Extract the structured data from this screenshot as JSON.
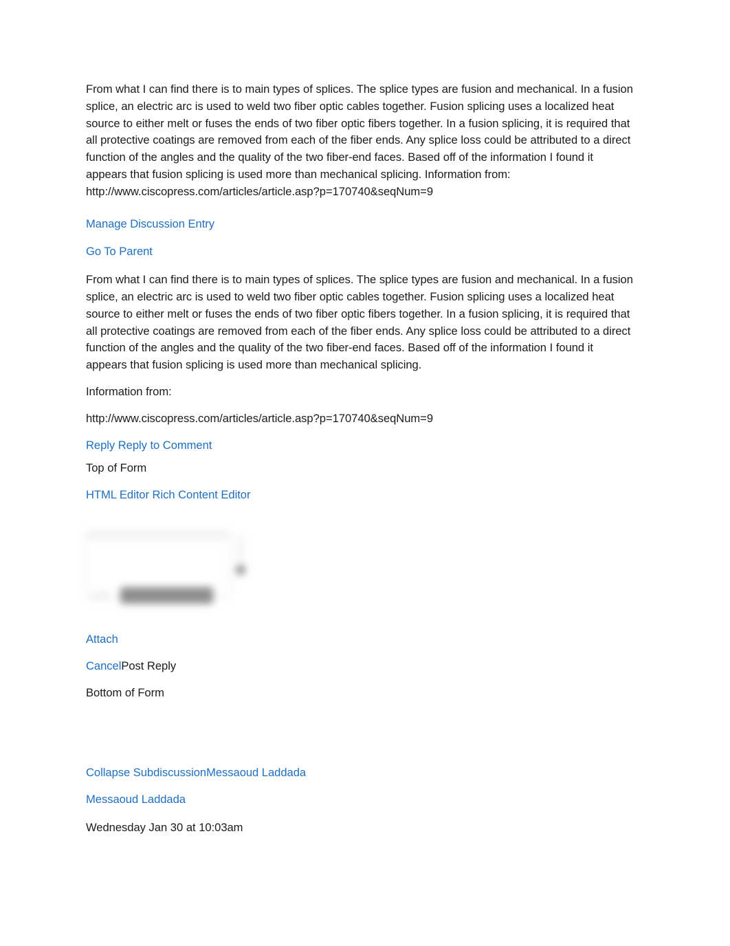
{
  "document": {
    "background_color": "#ffffff",
    "text_color": "#1b1b1b",
    "link_color": "#1f6fc0"
  },
  "entry_top": {
    "body": "From what I can find there is to main types of splices. The splice types are fusion and mechanical. In a fusion splice, an electric arc is used to weld two fiber optic cables together. Fusion splicing uses a localized heat source to either melt or fuses the ends of two fiber optic fibers together. In a fusion splicing, it is required that all protective coatings are removed from each of the fiber ends. Any splice loss could be attributed to a direct function of the angles and the quality of the two fiber-end faces. Based off of the information I found it appears that fusion splicing is used more than mechanical splicing. Information from: http://www.ciscopress.com/articles/article.asp?p=170740&seqNum=9",
    "manage_entry_link": "Manage Discussion Entry",
    "go_to_parent_link": "Go To Parent"
  },
  "entry_quoted": {
    "body": "From what I can find there is to main types of splices. The splice types are fusion and mechanical. In a fusion splice, an electric arc is used to weld two fiber optic cables together. Fusion splicing uses a localized heat source to either melt or fuses the ends of two fiber optic fibers together. In a fusion splicing, it is required that all protective coatings are removed from each of the fiber ends. Any splice loss could be attributed to a direct function of the angles and the quality of the two fiber-end faces. Based off of the information I found it appears that fusion splicing is used more than mechanical splicing.",
    "source_label": "Information from:",
    "source_url": "http://www.ciscopress.com/articles/article.asp?p=170740&seqNum=9",
    "reply_link": "Reply Reply to Comment"
  },
  "reply_form": {
    "top_marker": "Top of Form",
    "editor_toggle_link": "HTML Editor Rich Content Editor",
    "attach_link": "Attach",
    "cancel_link": "Cancel",
    "post_reply_label": "Post Reply",
    "bottom_marker": "Bottom of Form"
  },
  "subdiscussion": {
    "collapse_link": "Collapse SubdiscussionMessaoud Laddada",
    "author_link": "Messaoud Laddada",
    "timestamp": "Wednesday Jan 30 at 10:03am"
  }
}
